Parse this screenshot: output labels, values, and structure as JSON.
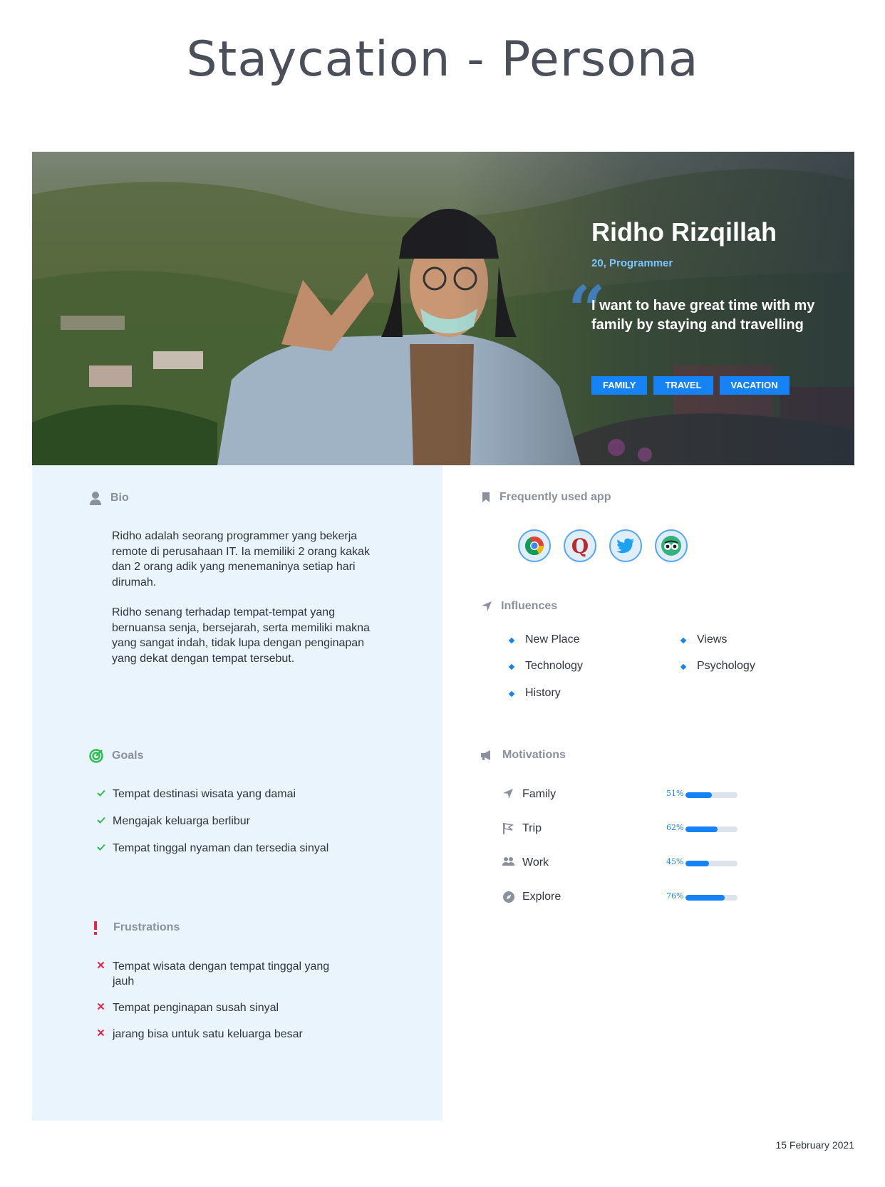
{
  "page": {
    "title": "Staycation - Persona",
    "date": "15 February 2021"
  },
  "hero": {
    "name": "Ridho Rizqillah",
    "subtitle": "20, Programmer",
    "quote_mark": "“",
    "quote": "I want to have great time with my family by staying and travelling",
    "tags": [
      "FAMILY",
      "TRAVEL",
      "VACATION"
    ]
  },
  "bio": {
    "heading": "Bio",
    "paragraphs": [
      "Ridho adalah seorang programmer yang bekerja remote di perusahaan IT. Ia memiliki 2 orang kakak dan 2 orang adik yang menemaninya setiap hari dirumah.",
      "Ridho senang terhadap tempat-tempat yang bernuansa senja, bersejarah, serta memiliki makna yang sangat indah, tidak lupa dengan penginapan yang dekat dengan tempat tersebut."
    ]
  },
  "goals": {
    "heading": "Goals",
    "items": [
      "Tempat destinasi wisata yang damai",
      "Mengajak keluarga berlibur",
      "Tempat tinggal nyaman dan tersedia sinyal"
    ]
  },
  "frustrations": {
    "heading": "Frustrations",
    "items": [
      "Tempat wisata dengan tempat tinggal yang jauh",
      "Tempat penginapan susah sinyal",
      "jarang bisa untuk satu keluarga besar"
    ]
  },
  "apps": {
    "heading": "Frequently used app",
    "items": [
      {
        "name": "Chrome",
        "icon": "chrome-icon"
      },
      {
        "name": "Quora",
        "icon": "quora-icon",
        "glyph": "Q"
      },
      {
        "name": "Twitter",
        "icon": "twitter-icon"
      },
      {
        "name": "TripAdvisor",
        "icon": "tripadvisor-icon"
      }
    ]
  },
  "influences": {
    "heading": "Influences",
    "items": [
      "New Place",
      "Views",
      "Technology",
      "Psychology",
      "History"
    ]
  },
  "motivations": {
    "heading": "Motivations",
    "items": [
      {
        "label": "Family",
        "percent": 51,
        "percent_label": "51%",
        "icon": "navigation-arrow-icon"
      },
      {
        "label": "Trip",
        "percent": 62,
        "percent_label": "62%",
        "icon": "flag-icon"
      },
      {
        "label": "Work",
        "percent": 45,
        "percent_label": "45%",
        "icon": "people-icon"
      },
      {
        "label": "Explore",
        "percent": 76,
        "percent_label": "76%",
        "icon": "compass-icon"
      }
    ]
  },
  "colors": {
    "accent": "#1583f5",
    "panel": "#eaf4fc",
    "goal_check": "#2dbe4e",
    "frustration": "#e8254a",
    "heading_grey": "#8a909c"
  }
}
